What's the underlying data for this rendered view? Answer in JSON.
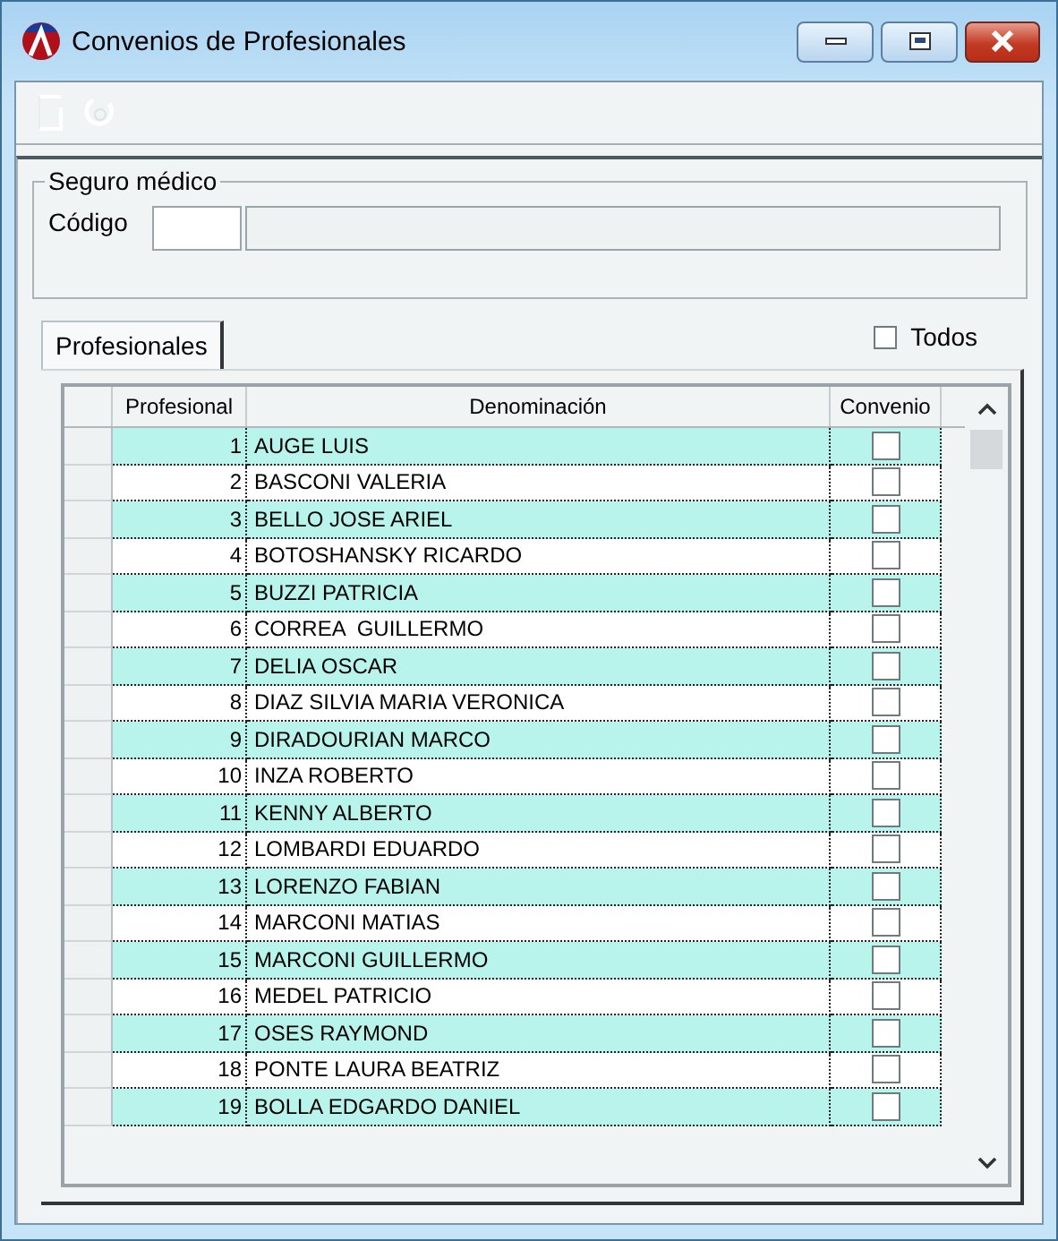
{
  "window": {
    "title": "Convenios de Profesionales"
  },
  "group": {
    "title": "Seguro médico",
    "code_label": "Código"
  },
  "tabs": [
    {
      "label": "Profesionales",
      "selected": true
    }
  ],
  "todos": {
    "label": "Todos",
    "checked": false
  },
  "table": {
    "columns": [
      "Profesional",
      "Denominación",
      "Convenio"
    ],
    "rows": [
      {
        "number": "1",
        "name": "AUGE LUIS",
        "convenio": false
      },
      {
        "number": "2",
        "name": "BASCONI VALERIA",
        "convenio": false
      },
      {
        "number": "3",
        "name": "BELLO JOSE ARIEL",
        "convenio": false
      },
      {
        "number": "4",
        "name": "BOTOSHANSKY RICARDO",
        "convenio": false
      },
      {
        "number": "5",
        "name": "BUZZI PATRICIA",
        "convenio": false
      },
      {
        "number": "6",
        "name": "CORREA  GUILLERMO",
        "convenio": false
      },
      {
        "number": "7",
        "name": "DELIA OSCAR",
        "convenio": false
      },
      {
        "number": "8",
        "name": "DIAZ SILVIA MARIA VERONICA",
        "convenio": false
      },
      {
        "number": "9",
        "name": "DIRADOURIAN MARCO",
        "convenio": false
      },
      {
        "number": "10",
        "name": "INZA ROBERTO",
        "convenio": false
      },
      {
        "number": "11",
        "name": "KENNY ALBERTO",
        "convenio": false
      },
      {
        "number": "12",
        "name": "LOMBARDI EDUARDO",
        "convenio": false
      },
      {
        "number": "13",
        "name": "LORENZO FABIAN",
        "convenio": false
      },
      {
        "number": "14",
        "name": "MARCONI MATIAS",
        "convenio": false
      },
      {
        "number": "15",
        "name": "MARCONI GUILLERMO",
        "convenio": false
      },
      {
        "number": "16",
        "name": "MEDEL PATRICIO",
        "convenio": false
      },
      {
        "number": "17",
        "name": "OSES RAYMOND",
        "convenio": false
      },
      {
        "number": "18",
        "name": "PONTE LAURA BEATRIZ",
        "convenio": false
      },
      {
        "number": "19",
        "name": "BOLLA EDGARDO DANIEL",
        "convenio": false
      }
    ]
  }
}
